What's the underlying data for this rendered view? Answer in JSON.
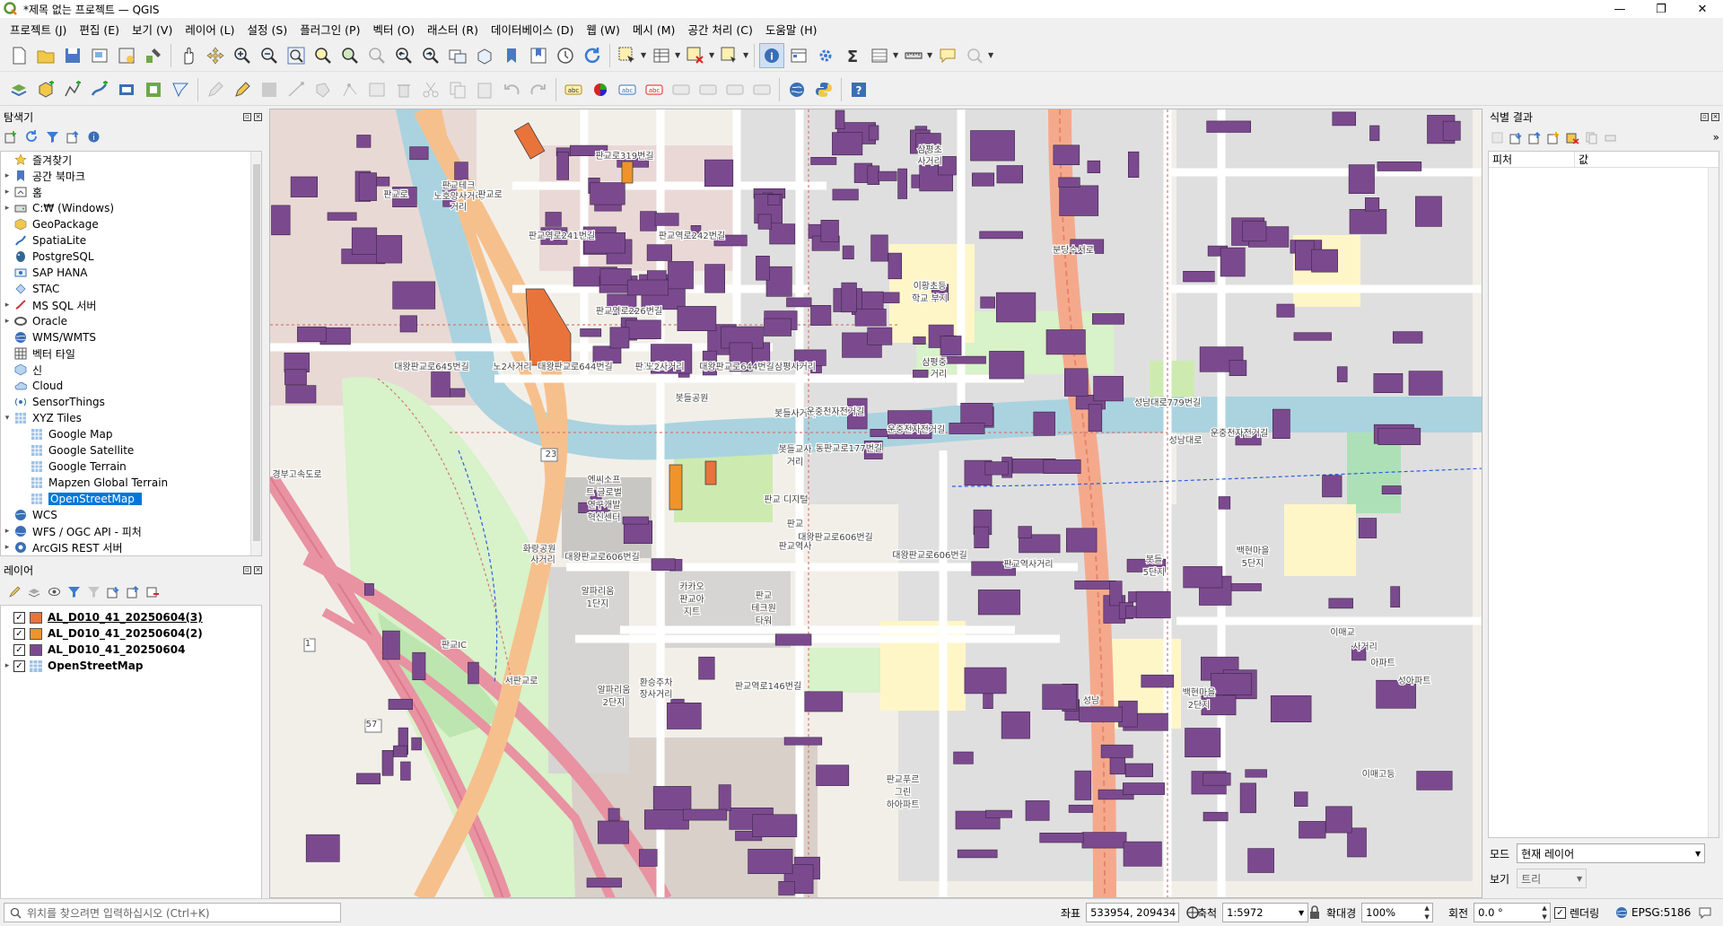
{
  "window": {
    "title": "*제목 없는 프로젝트 — QGIS",
    "minimize": "—",
    "maximize": "❐",
    "close": "✕"
  },
  "menubar": [
    "프로젝트 (J)",
    "편집 (E)",
    "보기 (V)",
    "레이어 (L)",
    "설정 (S)",
    "플러그인 (P)",
    "벡터 (O)",
    "래스터 (R)",
    "데이터베이스 (D)",
    "웹 (W)",
    "메시 (M)",
    "공간 처리 (C)",
    "도움말 (H)"
  ],
  "browser": {
    "title": "탐색기",
    "items": [
      {
        "label": "즐겨찾기",
        "icon": "star-icon",
        "arrow": ""
      },
      {
        "label": "공간 북마크",
        "icon": "bookmark-icon",
        "arrow": "▸"
      },
      {
        "label": "홈",
        "icon": "home-icon",
        "arrow": "▸"
      },
      {
        "label": "C:₩ (Windows)",
        "icon": "drive-icon",
        "arrow": "▸"
      },
      {
        "label": "GeoPackage",
        "icon": "geopackage-icon",
        "arrow": ""
      },
      {
        "label": "SpatiaLite",
        "icon": "spatialite-icon",
        "arrow": ""
      },
      {
        "label": "PostgreSQL",
        "icon": "postgresql-icon",
        "arrow": ""
      },
      {
        "label": "SAP HANA",
        "icon": "sap-hana-icon",
        "arrow": ""
      },
      {
        "label": "STAC",
        "icon": "stac-icon",
        "arrow": ""
      },
      {
        "label": "MS SQL 서버",
        "icon": "mssql-icon",
        "arrow": "▸"
      },
      {
        "label": "Oracle",
        "icon": "oracle-icon",
        "arrow": "▸"
      },
      {
        "label": "WMS/WMTS",
        "icon": "wms-icon",
        "arrow": ""
      },
      {
        "label": "벡터 타일",
        "icon": "vector-tile-icon",
        "arrow": ""
      },
      {
        "label": "신",
        "icon": "scene-icon",
        "arrow": ""
      },
      {
        "label": "Cloud",
        "icon": "cloud-icon",
        "arrow": ""
      },
      {
        "label": "SensorThings",
        "icon": "sensorthings-icon",
        "arrow": ""
      },
      {
        "label": "XYZ Tiles",
        "icon": "xyz-tiles-icon",
        "arrow": "▾"
      }
    ],
    "xyz_children": [
      {
        "label": "Google Map",
        "selected": false
      },
      {
        "label": "Google Satellite",
        "selected": false
      },
      {
        "label": "Google Terrain",
        "selected": false
      },
      {
        "label": "Mapzen Global Terrain",
        "selected": false
      },
      {
        "label": "OpenStreetMap",
        "selected": true
      }
    ],
    "after_items": [
      {
        "label": "WCS",
        "icon": "wcs-icon",
        "arrow": ""
      },
      {
        "label": "WFS / OGC API - 피처",
        "icon": "wfs-icon",
        "arrow": "▸"
      },
      {
        "label": "ArcGIS REST 서버",
        "icon": "arcgis-icon",
        "arrow": "▸"
      }
    ]
  },
  "layers": {
    "title": "레이어",
    "items": [
      {
        "label": "AL_D010_41_20250604(3)",
        "color": "#e8743b",
        "checked": "✓",
        "underline": true
      },
      {
        "label": "AL_D010_41_20250604(2)",
        "color": "#f0932b",
        "checked": "✓",
        "underline": false
      },
      {
        "label": "AL_D010_41_20250604",
        "color": "#7b4a8e",
        "checked": "✓",
        "underline": false
      },
      {
        "label": "OpenStreetMap",
        "color": "",
        "checked": "✓",
        "underline": false
      }
    ]
  },
  "identify": {
    "title": "식별 결과",
    "col_feature": "피처",
    "col_value": "값",
    "mode_label": "모드",
    "mode_value": "현재 레이어",
    "view_label": "보기",
    "view_value": "트리"
  },
  "statusbar": {
    "locator_placeholder": "위치를 찾으려면 입력하십시오 (Ctrl+K)",
    "coord_label": "좌표",
    "coord_value": "533954, 209434",
    "scale_label": "축척",
    "scale_value": "1:5972",
    "magnifier_label": "확대경",
    "magnifier_value": "100%",
    "rotation_label": "회전",
    "rotation_value": "0.0 °",
    "render_label": "렌더링",
    "crs_value": "EPSG:5186"
  },
  "map": {
    "labels": [
      {
        "t": "판교로319번길"
      },
      {
        "t": "판교로"
      },
      {
        "t": "판교테크"
      },
      {
        "t": "노호양사거리"
      },
      {
        "t": "판교로"
      },
      {
        "t": "거리"
      },
      {
        "t": "판교역로241번길"
      },
      {
        "t": "판교역로242번길"
      },
      {
        "t": "판교역로226번길"
      },
      {
        "t": "대왕판교로645번길"
      },
      {
        "t": "노2사거리"
      },
      {
        "t": "대왕판교로644번길"
      },
      {
        "t": "판교테크"
      },
      {
        "t": "노2사거리"
      },
      {
        "t": "대왕판교로644번길"
      },
      {
        "t": "삼평사거리"
      },
      {
        "t": "이황초등"
      },
      {
        "t": "학교 부지"
      },
      {
        "t": "삼평중"
      },
      {
        "t": "거리"
      },
      {
        "t": "봇들공원"
      },
      {
        "t": "봇들사거리"
      },
      {
        "t": "운중천자전거길"
      },
      {
        "t": "성남대로779번길"
      },
      {
        "t": "운중천자전거길"
      },
      {
        "t": "동판교로177번길"
      },
      {
        "t": "봇들교사"
      },
      {
        "t": "거리"
      },
      {
        "t": "판교 디지털"
      },
      {
        "t": "대왕판교로606번길"
      },
      {
        "t": "판교"
      },
      {
        "t": "엔씨소프"
      },
      {
        "t": "트 글로벌"
      },
      {
        "t": "연구개발"
      },
      {
        "t": "혁신센터"
      },
      {
        "t": "화랑공원"
      },
      {
        "t": "사거리"
      },
      {
        "t": "대왕판교로606번길"
      },
      {
        "t": "판교역사"
      },
      {
        "t": "대왕판교로606번길"
      },
      {
        "t": "판교역사거리"
      },
      {
        "t": "카카오"
      },
      {
        "t": "판교아"
      },
      {
        "t": "지트"
      },
      {
        "t": "판교"
      },
      {
        "t": "테크원"
      },
      {
        "t": "타워"
      },
      {
        "t": "알파리움"
      },
      {
        "t": "1단지"
      },
      {
        "t": "알파리움"
      },
      {
        "t": "2단지"
      },
      {
        "t": "환승주차"
      },
      {
        "t": "장사거리"
      },
      {
        "t": "판교역로146번길"
      },
      {
        "t": "판교푸르"
      },
      {
        "t": "그린"
      },
      {
        "t": "하아파트"
      },
      {
        "t": "백현마을"
      },
      {
        "t": "2단지"
      },
      {
        "t": "이매교"
      },
      {
        "t": "사거리"
      },
      {
        "t": "성남"
      },
      {
        "t": "이매고등"
      },
      {
        "t": "아파트"
      },
      {
        "t": "성아파트"
      },
      {
        "t": "성남대로"
      },
      {
        "t": "판교IC"
      },
      {
        "t": "서판교로"
      },
      {
        "t": "1"
      },
      {
        "t": "23"
      },
      {
        "t": "57"
      },
      {
        "t": "경부고속도로"
      },
      {
        "t": "삼평초"
      },
      {
        "t": "사거리"
      },
      {
        "t": "분당수서로"
      },
      {
        "t": "운중천자전거길"
      },
      {
        "t": "봇들"
      },
      {
        "t": "5단지"
      },
      {
        "t": "백현마을"
      },
      {
        "t": "5단지"
      }
    ]
  }
}
